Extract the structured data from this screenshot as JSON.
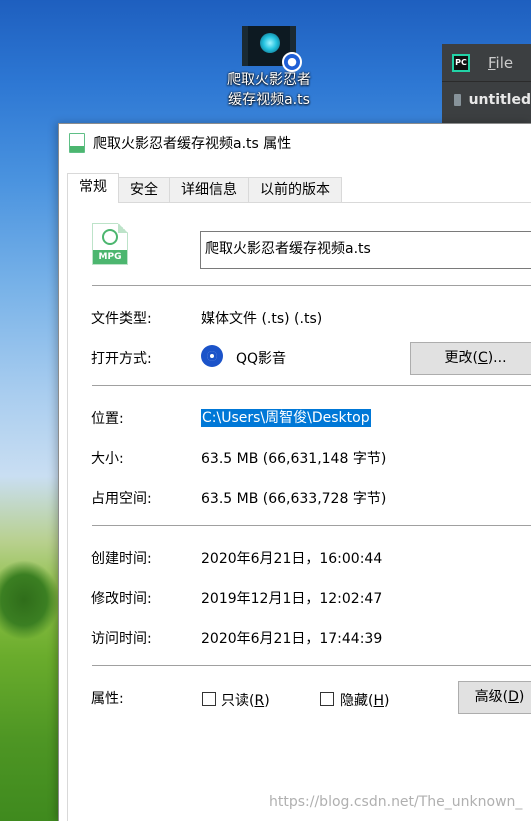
{
  "desktop": {
    "icon_label_line1": "爬取火影忍者",
    "icon_label_line2": "缓存视频a.ts"
  },
  "ide": {
    "logo": "PC",
    "menu_first_letter": "F",
    "menu_rest": "ile",
    "project_label": "untitled"
  },
  "dialog": {
    "title": "爬取火影忍者缓存视频a.ts 属性",
    "tabs": [
      "常规",
      "安全",
      "详细信息",
      "以前的版本"
    ],
    "file_icon_text": "MPG",
    "file_name": "爬取火影忍者缓存视频a.ts",
    "type": {
      "label": "文件类型:",
      "value": "媒体文件 (.ts) (.ts)"
    },
    "opens_with": {
      "label": "打开方式:",
      "app": "QQ影音",
      "change_prefix": "更改(",
      "change_key": "C",
      "change_suffix": ")..."
    },
    "location": {
      "label": "位置:",
      "value": "C:\\Users\\周智俊\\Desktop"
    },
    "size": {
      "label": "大小:",
      "value": "63.5 MB (66,631,148 字节)"
    },
    "size_on_disk": {
      "label": "占用空间:",
      "value": "63.5 MB (66,633,728 字节)"
    },
    "created": {
      "label": "创建时间:",
      "value": "2020年6月21日，16:00:44"
    },
    "modified": {
      "label": "修改时间:",
      "value": "2019年12月1日，12:02:47"
    },
    "accessed": {
      "label": "访问时间:",
      "value": "2020年6月21日，17:44:39"
    },
    "attributes": {
      "label": "属性:",
      "readonly_prefix": "只读(",
      "readonly_key": "R",
      "readonly_suffix": ")",
      "hidden_prefix": "隐藏(",
      "hidden_key": "H",
      "hidden_suffix": ")",
      "advanced_prefix": "高级(",
      "advanced_key": "D",
      "advanced_suffix": ")"
    }
  },
  "watermark": "https://blog.csdn.net/The_unknown_"
}
